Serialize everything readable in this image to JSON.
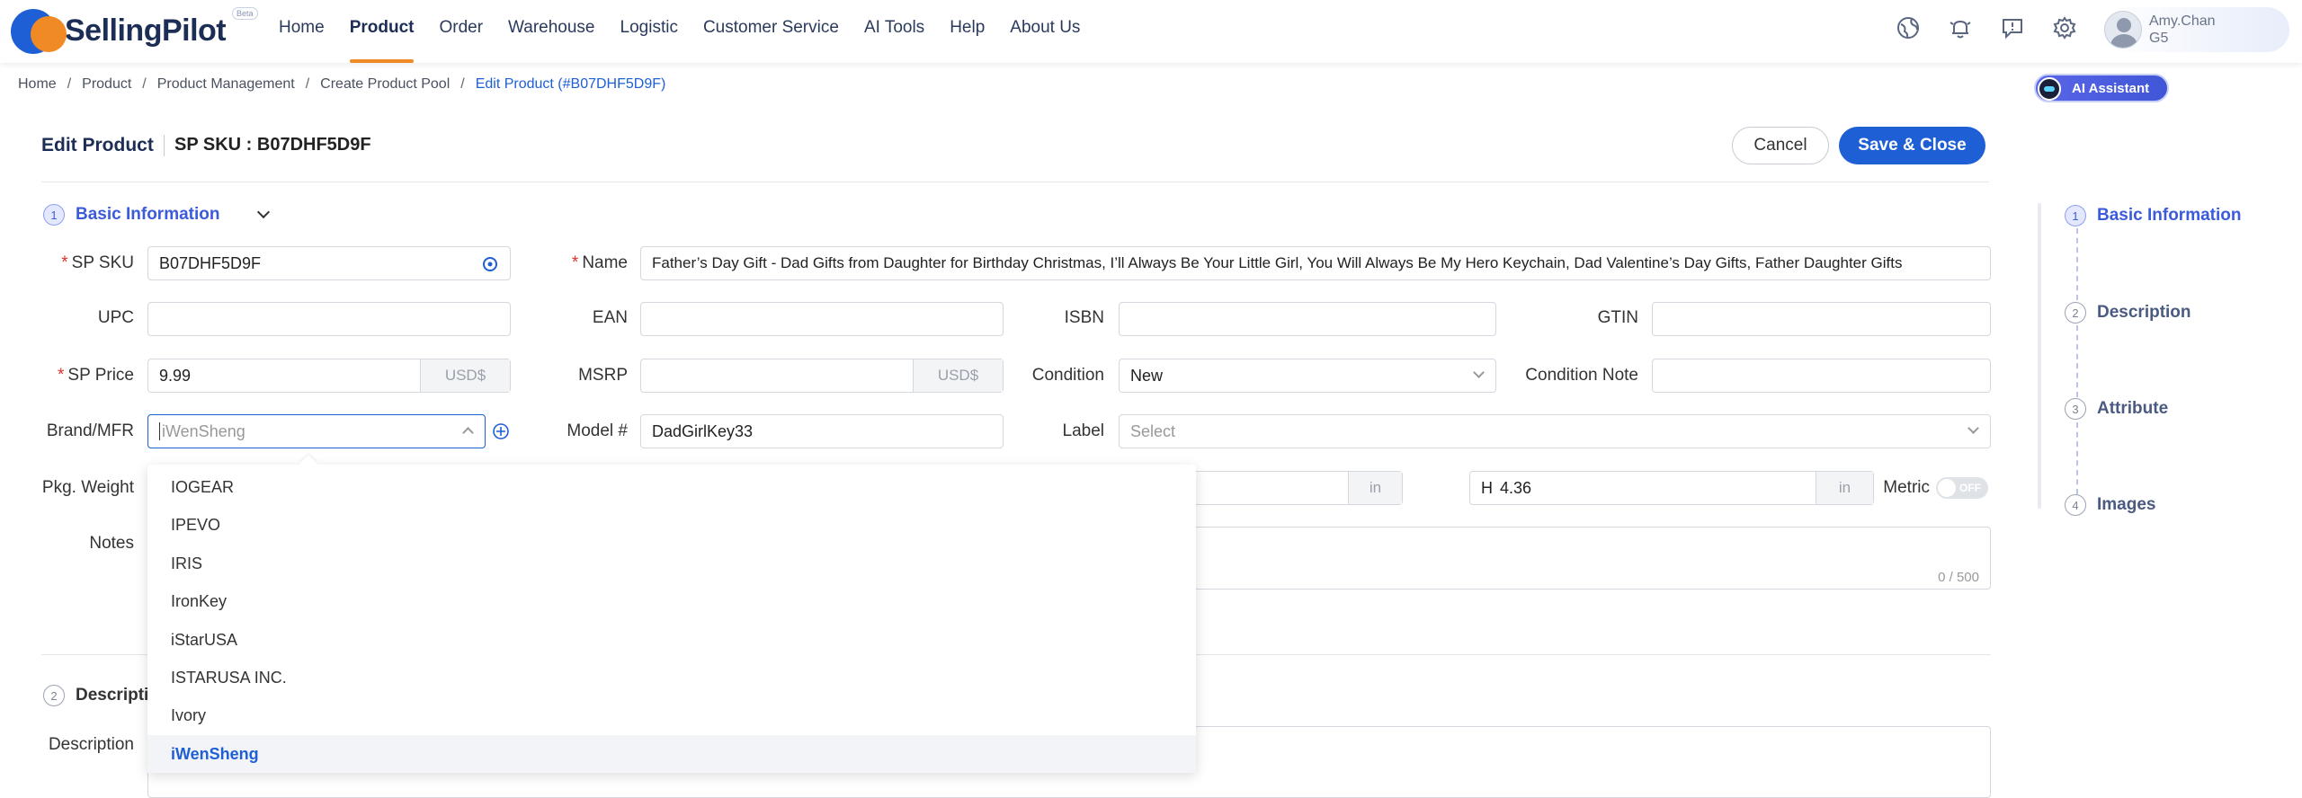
{
  "app": {
    "name": "SellingPilot",
    "badge": "Beta"
  },
  "nav": [
    "Home",
    "Product",
    "Order",
    "Warehouse",
    "Logistic",
    "Customer Service",
    "AI Tools",
    "Help",
    "About Us"
  ],
  "user": {
    "name": "Amy.Chan",
    "level": "G5"
  },
  "breadcrumb": [
    "Home",
    "Product",
    "Product Management",
    "Create Product Pool",
    "Edit Product (#B07DHF5D9F)"
  ],
  "ai_assistant": "AI Assistant",
  "header": {
    "title": "Edit Product",
    "sku": "SP SKU : B07DHF5D9F",
    "cancel": "Cancel",
    "save": "Save & Close"
  },
  "basic": {
    "num": "1",
    "title": "Basic Information",
    "sp_sku_label": "SP SKU",
    "sp_sku": "B07DHF5D9F",
    "name_label": "Name",
    "name": "Father’s Day Gift - Dad Gifts from Daughter for Birthday Christmas, I’ll Always Be Your Little Girl, You Will Always Be My Hero Keychain, Dad Valentine’s Day Gifts, Father Daughter Gifts",
    "upc_label": "UPC",
    "upc": "",
    "ean_label": "EAN",
    "ean": "",
    "isbn_label": "ISBN",
    "isbn": "",
    "gtin_label": "GTIN",
    "gtin": "",
    "sp_price_label": "SP Price",
    "sp_price": "9.99",
    "currency": "USD$",
    "msrp_label": "MSRP",
    "msrp": "",
    "condition_label": "Condition",
    "condition": "New",
    "condition_note_label": "Condition Note",
    "condition_note": "",
    "brand_label": "Brand/MFR",
    "brand_placeholder": "iWenSheng",
    "model_label": "Model #",
    "model": "DadGirlKey33",
    "label_label": "Label",
    "label_placeholder": "Select",
    "pkg_weight_label": "Pkg. Weight",
    "dim_unit": "in",
    "h_prefix": "H",
    "h_value": "4.36",
    "metric_label": "Metric",
    "metric_toggle": "OFF",
    "notes_label": "Notes",
    "notes_count": "0 / 500"
  },
  "brand_options": [
    "IOGEAR",
    "IPEVO",
    "IRIS",
    "IronKey",
    "iStarUSA",
    "ISTARUSA INC.",
    "Ivory",
    "iWenSheng"
  ],
  "description_section": {
    "num": "2",
    "title": "Descripti",
    "label": "Description"
  },
  "steps": [
    {
      "num": "1",
      "label": "Basic Information"
    },
    {
      "num": "2",
      "label": "Description"
    },
    {
      "num": "3",
      "label": "Attribute"
    },
    {
      "num": "4",
      "label": "Images"
    }
  ],
  "colors": {
    "primary": "#1e5fd6",
    "accent": "#f08a24",
    "section": "#3b5bdb"
  }
}
